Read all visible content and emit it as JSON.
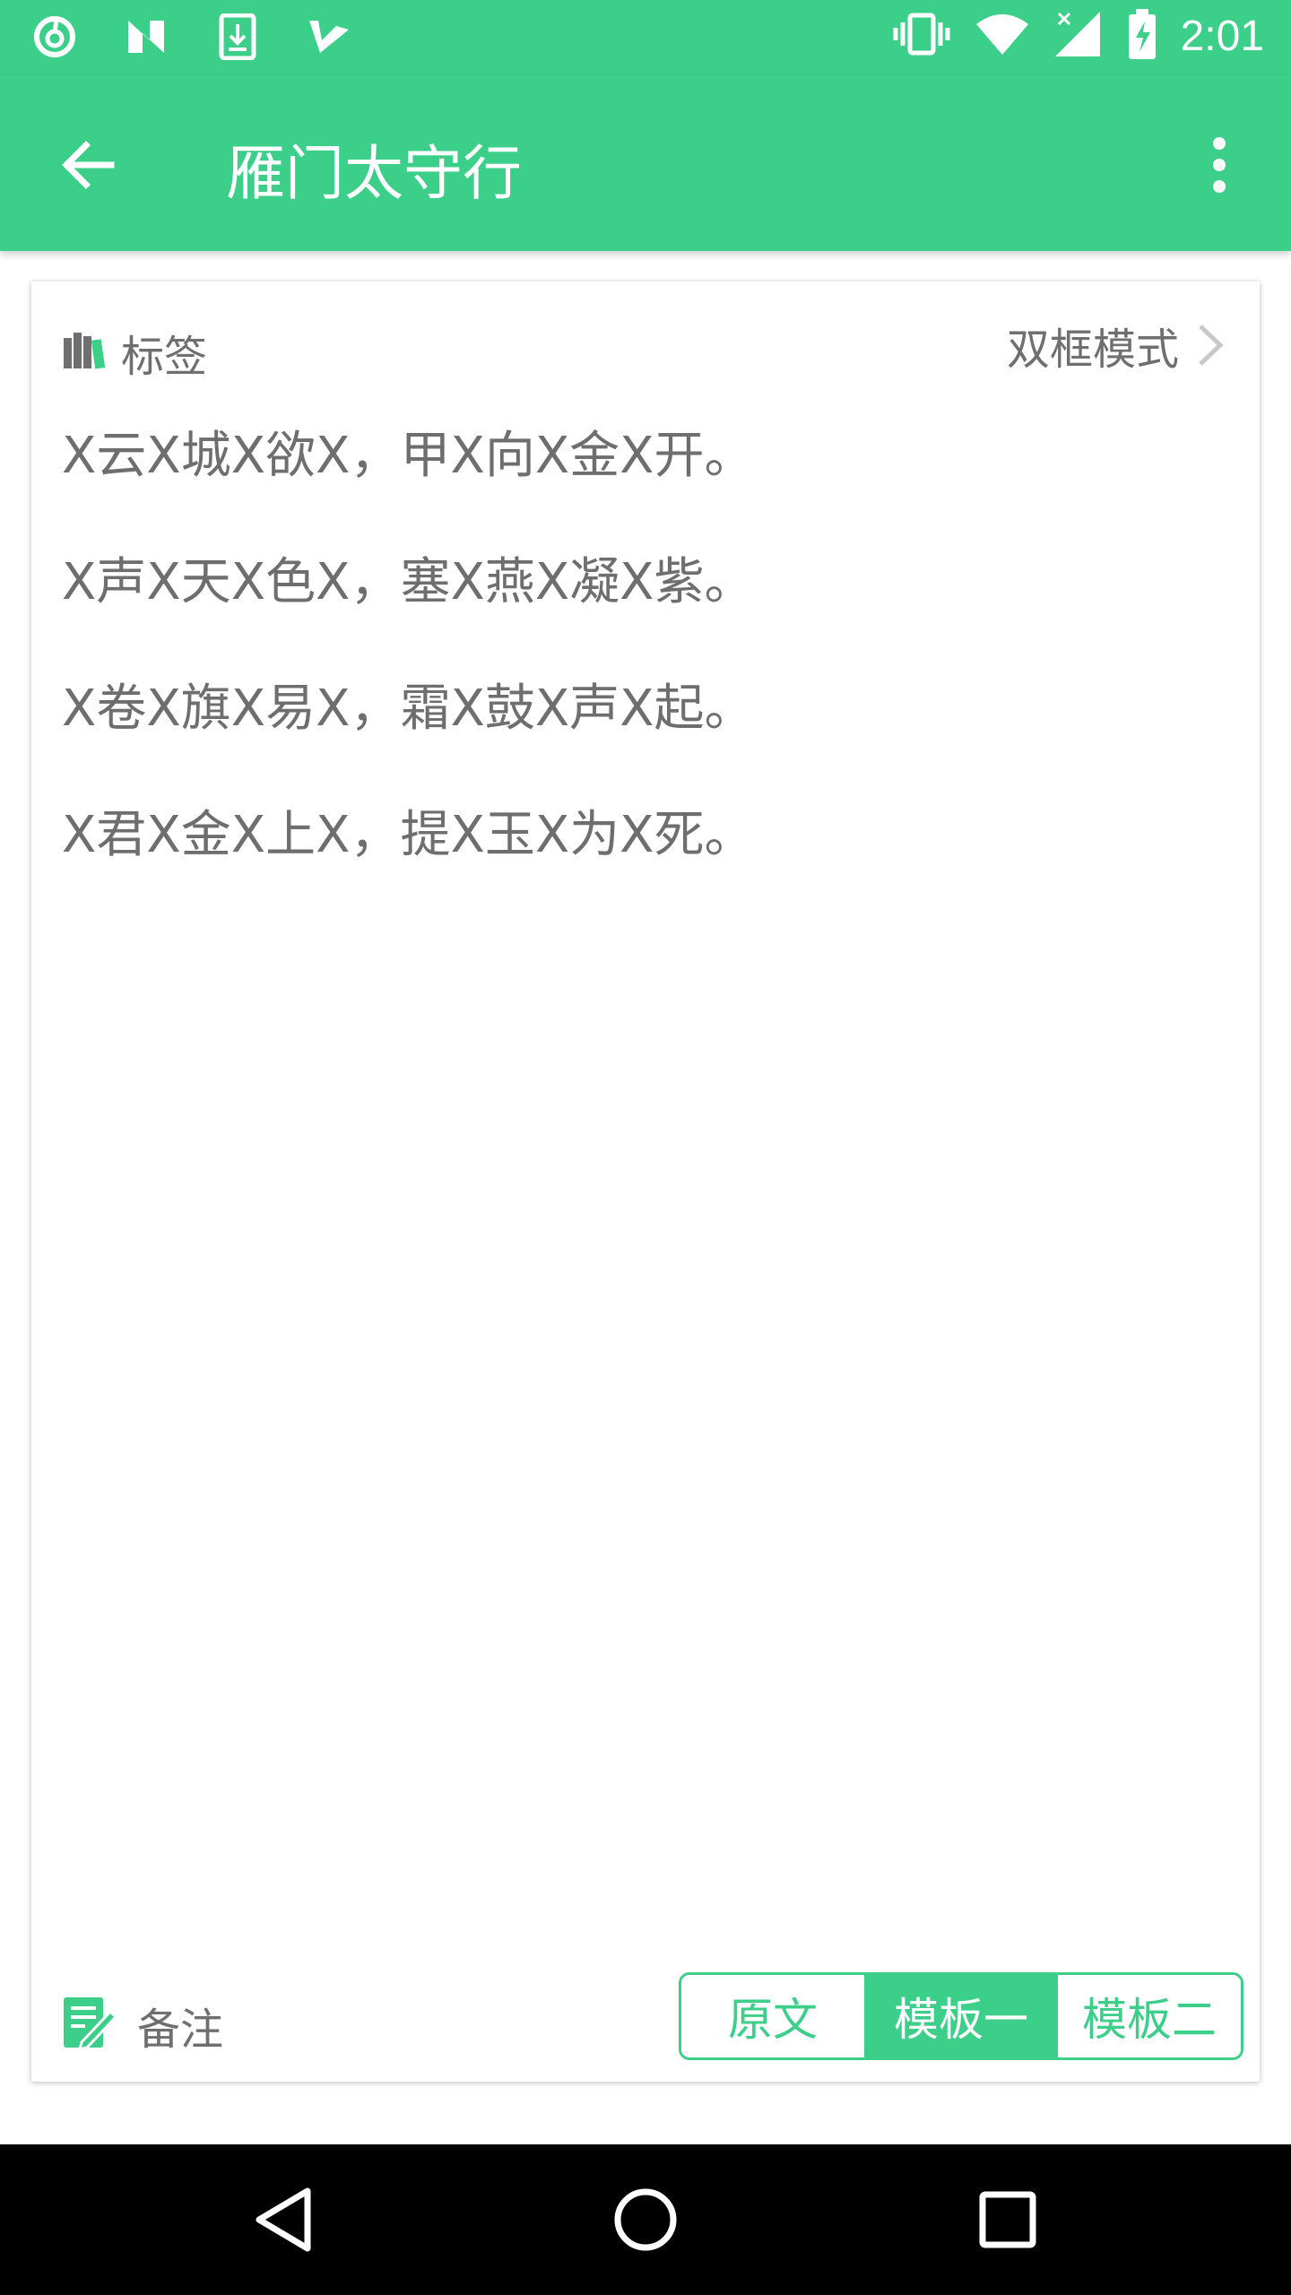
{
  "status_bar": {
    "time": "2:01",
    "left_icons": [
      "netease-music-icon",
      "n-app-icon",
      "download-icon",
      "check-icon"
    ],
    "right_icons": [
      "vibrate-icon",
      "wifi-icon",
      "signal-icon",
      "battery-charging-icon"
    ]
  },
  "app_bar": {
    "title": "雁门太守行",
    "back_icon": "arrow-left-icon",
    "menu_icon": "more-vert-icon"
  },
  "card": {
    "tag_label": "标签",
    "mode_label": "双框模式",
    "poem_lines": [
      "X云X城X欲X，甲X向X金X开。",
      "X声X天X色X，塞X燕X凝X紫。",
      "X卷X旗X易X，霜X鼓X声X起。",
      "X君X金X上X，提X玉X为X死。"
    ],
    "note_label": "备注",
    "segments": [
      {
        "label": "原文",
        "selected": false
      },
      {
        "label": "模板一",
        "selected": true
      },
      {
        "label": "模板二",
        "selected": false
      }
    ]
  },
  "colors": {
    "accent": "#3ccf89",
    "text_gray": "#6e6e6e",
    "nav_bg": "#000000"
  }
}
